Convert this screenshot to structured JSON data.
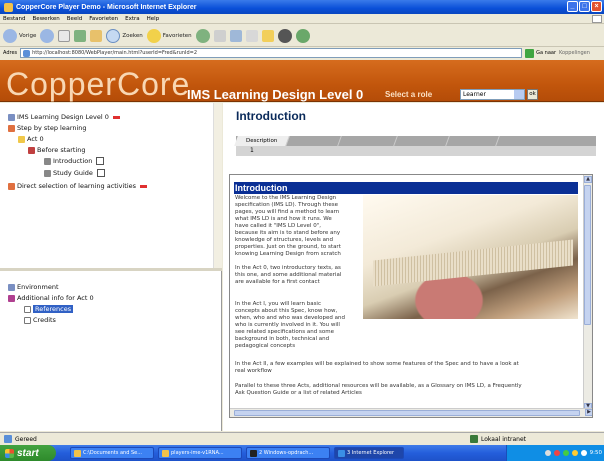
{
  "window": {
    "title": "CopperCore Player Demo - Microsoft Internet Explorer"
  },
  "menu": [
    "Bestand",
    "Bewerken",
    "Beeld",
    "Favorieten",
    "Extra",
    "Help"
  ],
  "toolbar": {
    "back": "Vorige",
    "search": "Zoeken",
    "favorites": "Favorieten"
  },
  "address": {
    "label": "Adres",
    "url": "http://localhost:8080/WebPlayer/main.html?userId=Fred&runId=2",
    "go": "Ga naar",
    "links": "Koppelingen"
  },
  "app": {
    "brand": "CopperCore",
    "ld_title": "IMS Learning Design Level 0",
    "role_label": "Select a role",
    "role_value": "Learner",
    "ok": "ok"
  },
  "tree_top": {
    "root": "IMS Learning Design Level 0",
    "step": "Step by step learning",
    "act": "Act 0",
    "before": "Before starting",
    "intro": "Introduction",
    "study": "Study Guide",
    "direct": "Direct selection of learning activities"
  },
  "tree_bottom": {
    "environment": "Environment",
    "additional": "Additional info for Act 0",
    "references": "References",
    "credits": "Credits"
  },
  "content": {
    "page_title": "Introduction",
    "tab_active": "Description",
    "step_number": "1",
    "heading": "Introduction",
    "paragraphs": {
      "p1_l1": "Welcome to the IMS Learning Design",
      "p1_l2": "specification (IMS LD). Through these",
      "p1_l3": "pages, you will find a method to learn",
      "p1_l4": "what IMS LD is and how it runs. We",
      "p1_l5": "have called it \"IMS LD Level 0\",",
      "p1_l6": "because its aim is to stand before any",
      "p1_l7": "knowledge of structures, levels and",
      "p1_l8": "properties. Just on the ground, to start",
      "p1_l9": "knowing Learning Design from scratch",
      "p2_l1": "In the Act 0, two introductory texts, as",
      "p2_l2": "this one, and some additional material",
      "p2_l3": "are available for a first contact",
      "p3_l1": "In the Act I, you will learn basic",
      "p3_l2": "concepts about this Spec, know how,",
      "p3_l3": "when, who and who was developed and",
      "p3_l4": "who is currently involved in it. You will",
      "p3_l5": "see related specifications and some",
      "p3_l6": "background in both, technical and",
      "p3_l7": "pedagogical concepts",
      "p4_l1": "In the Act II, a few examples will be explained to show some features of the Spec and to have a look at",
      "p4_l2": "real workflow",
      "p5_l1": "Parallel to these three Acts, additional resources will be available, as a Glossary on IMS LD, a Frequently",
      "p5_l2": "Ask Question Guide or a list of related Articles"
    }
  },
  "status": {
    "text": "Gereed",
    "zone": "Lokaal intranet"
  },
  "taskbar": {
    "start": "start",
    "items": [
      "C:\\Documents and Se...",
      "players-ime-v1RNA...",
      "2 Windows-opdrach...",
      "3 Internet Explorer"
    ],
    "clock": "9:50"
  }
}
